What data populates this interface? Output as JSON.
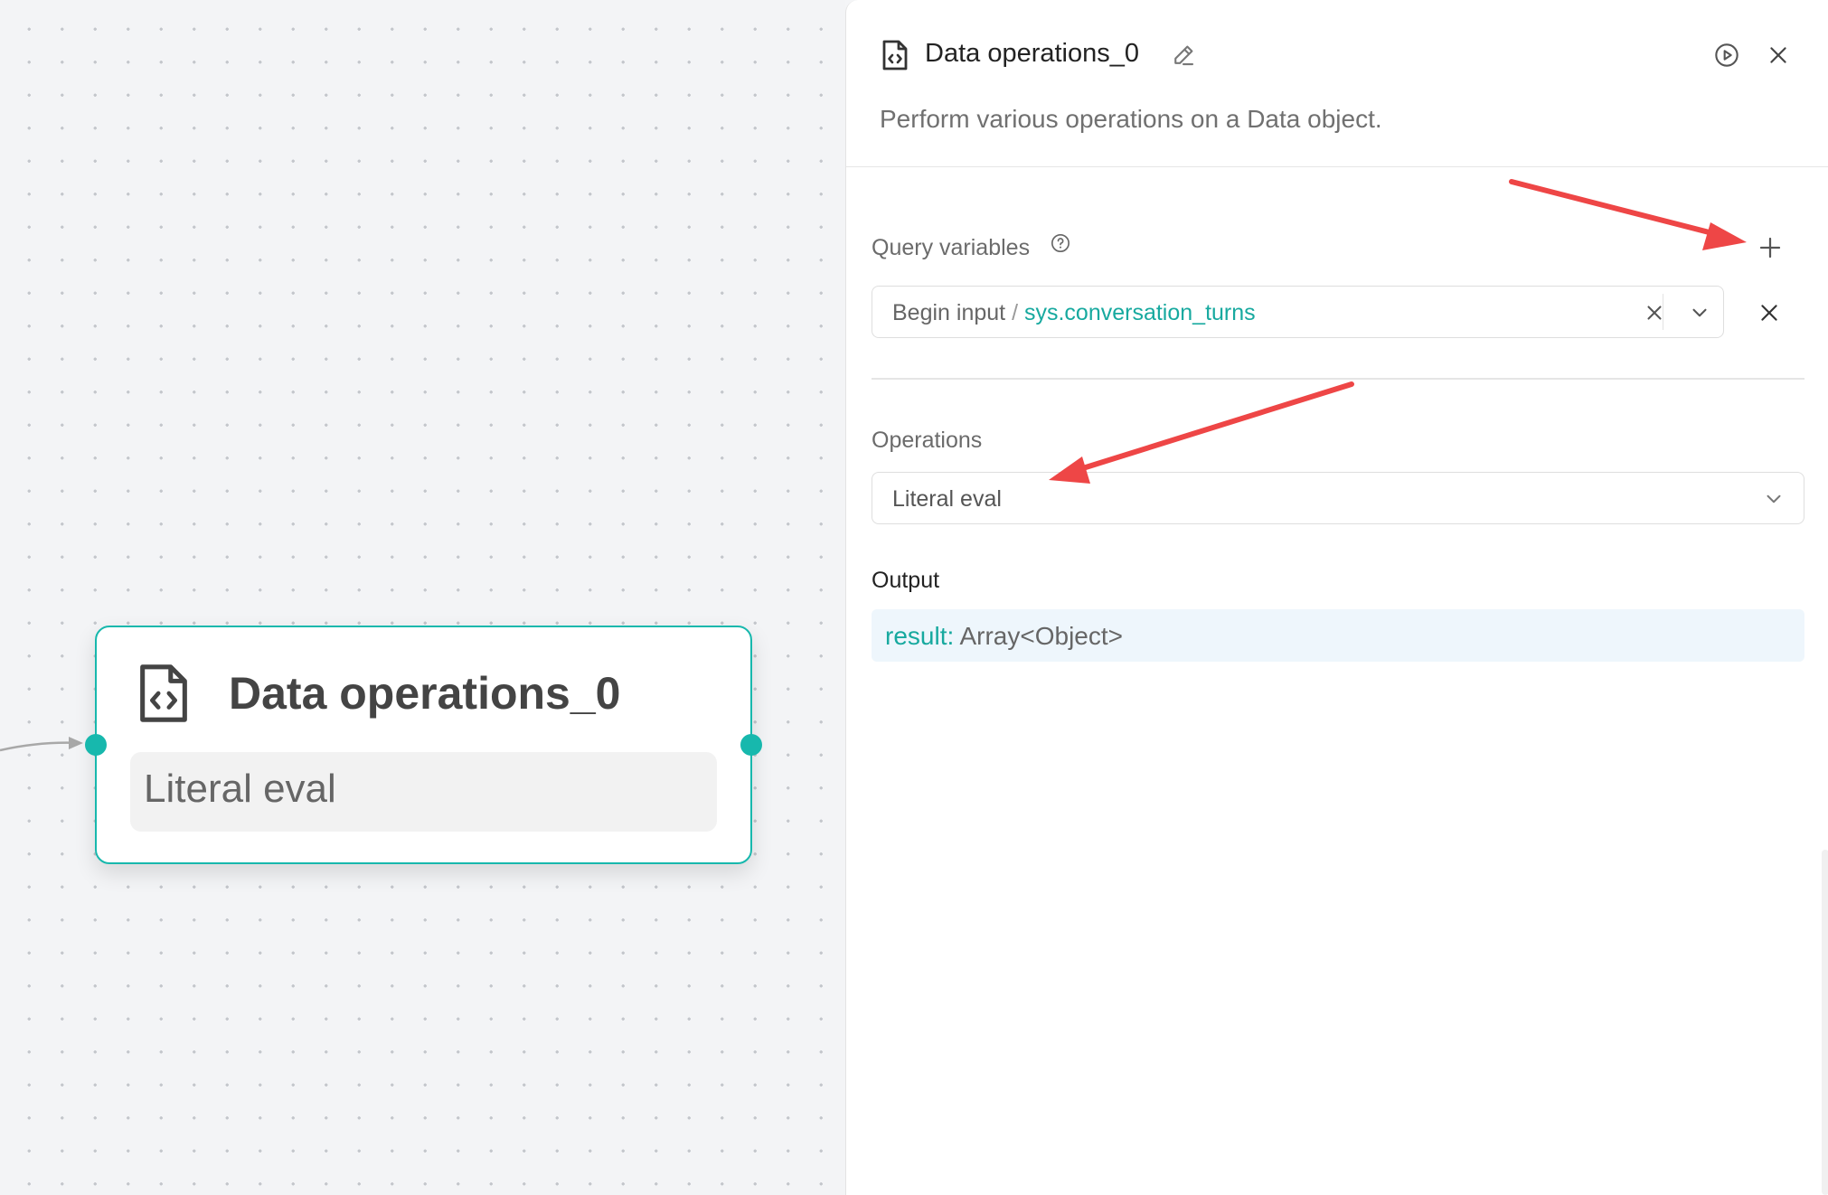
{
  "canvas": {
    "node": {
      "title": "Data operations_0",
      "operation": "Literal eval",
      "icon": "file-code-icon"
    }
  },
  "panel": {
    "title": "Data operations_0",
    "description": "Perform various operations on a Data object.",
    "icons": {
      "header": "file-code-icon",
      "edit": "pencil-icon",
      "run": "play-circle-icon",
      "close": "close-icon"
    },
    "query_variables": {
      "label": "Query variables",
      "items": [
        {
          "source": "Begin input",
          "separator": "/",
          "variable": "sys.conversation_turns"
        }
      ]
    },
    "operations": {
      "label": "Operations",
      "selected": "Literal eval"
    },
    "output": {
      "label": "Output",
      "key": "result:",
      "type": "Array<Object>"
    }
  },
  "colors": {
    "accent": "#17b8ad",
    "annotation_arrow": "#ee4646",
    "output_bg": "#eef6fc"
  }
}
